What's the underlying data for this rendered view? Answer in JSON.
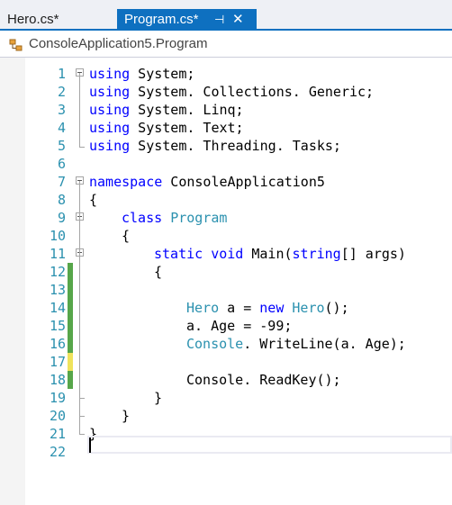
{
  "tabs": {
    "inactive_label": "Hero.cs*",
    "active_label": "Program.cs*",
    "pin_glyph": "⊣",
    "close_glyph": "✕"
  },
  "nav": {
    "label": "ConsoleApplication5.Program",
    "icon": "class-icon"
  },
  "colors": {
    "keyword": "#0000ff",
    "type": "#2b91af",
    "line_number": "#2b91af",
    "change_saved": "#57a64a",
    "change_unsaved": "#efe35c",
    "accent": "#0e70c0"
  },
  "lines": [
    {
      "n": "1",
      "tokens": [
        {
          "t": "using",
          "c": "kw"
        },
        {
          "t": " System;"
        }
      ]
    },
    {
      "n": "2",
      "tokens": [
        {
          "t": "using",
          "c": "kw"
        },
        {
          "t": " System. Collections. Generic;"
        }
      ]
    },
    {
      "n": "3",
      "tokens": [
        {
          "t": "using",
          "c": "kw"
        },
        {
          "t": " System. Linq;"
        }
      ]
    },
    {
      "n": "4",
      "tokens": [
        {
          "t": "using",
          "c": "kw"
        },
        {
          "t": " System. Text;"
        }
      ]
    },
    {
      "n": "5",
      "tokens": [
        {
          "t": "using",
          "c": "kw"
        },
        {
          "t": " System. Threading. Tasks;"
        }
      ]
    },
    {
      "n": "6",
      "tokens": []
    },
    {
      "n": "7",
      "tokens": [
        {
          "t": "namespace",
          "c": "kw"
        },
        {
          "t": " ConsoleApplication5"
        }
      ]
    },
    {
      "n": "8",
      "tokens": [
        {
          "t": "{"
        }
      ]
    },
    {
      "n": "9",
      "tokens": [
        {
          "t": "class",
          "c": "kw"
        },
        {
          "t": " "
        },
        {
          "t": "Program",
          "c": "ty"
        }
      ]
    },
    {
      "n": "10",
      "tokens": [
        {
          "t": "{"
        }
      ]
    },
    {
      "n": "11",
      "tokens": [
        {
          "t": "static",
          "c": "kw"
        },
        {
          "t": " "
        },
        {
          "t": "void",
          "c": "kw"
        },
        {
          "t": " Main("
        },
        {
          "t": "string",
          "c": "kw"
        },
        {
          "t": "[] args)"
        }
      ]
    },
    {
      "n": "12",
      "tokens": [
        {
          "t": "{"
        }
      ]
    },
    {
      "n": "13",
      "tokens": []
    },
    {
      "n": "14",
      "tokens": [
        {
          "t": "Hero",
          "c": "ty"
        },
        {
          "t": " a = "
        },
        {
          "t": "new",
          "c": "kw"
        },
        {
          "t": " "
        },
        {
          "t": "Hero",
          "c": "ty"
        },
        {
          "t": "();"
        }
      ]
    },
    {
      "n": "15",
      "tokens": [
        {
          "t": "a. Age = -99;"
        }
      ]
    },
    {
      "n": "16",
      "tokens": [
        {
          "t": "Console",
          "c": "ty"
        },
        {
          "t": ". WriteLine(a. Age);"
        }
      ]
    },
    {
      "n": "17",
      "tokens": []
    },
    {
      "n": "18",
      "tokens": [
        {
          "t": "Console. ReadKey();"
        }
      ]
    },
    {
      "n": "19",
      "tokens": [
        {
          "t": "}"
        }
      ]
    },
    {
      "n": "20",
      "tokens": [
        {
          "t": "}"
        }
      ]
    },
    {
      "n": "21",
      "tokens": [
        {
          "t": "}"
        }
      ]
    },
    {
      "n": "22",
      "tokens": []
    }
  ]
}
